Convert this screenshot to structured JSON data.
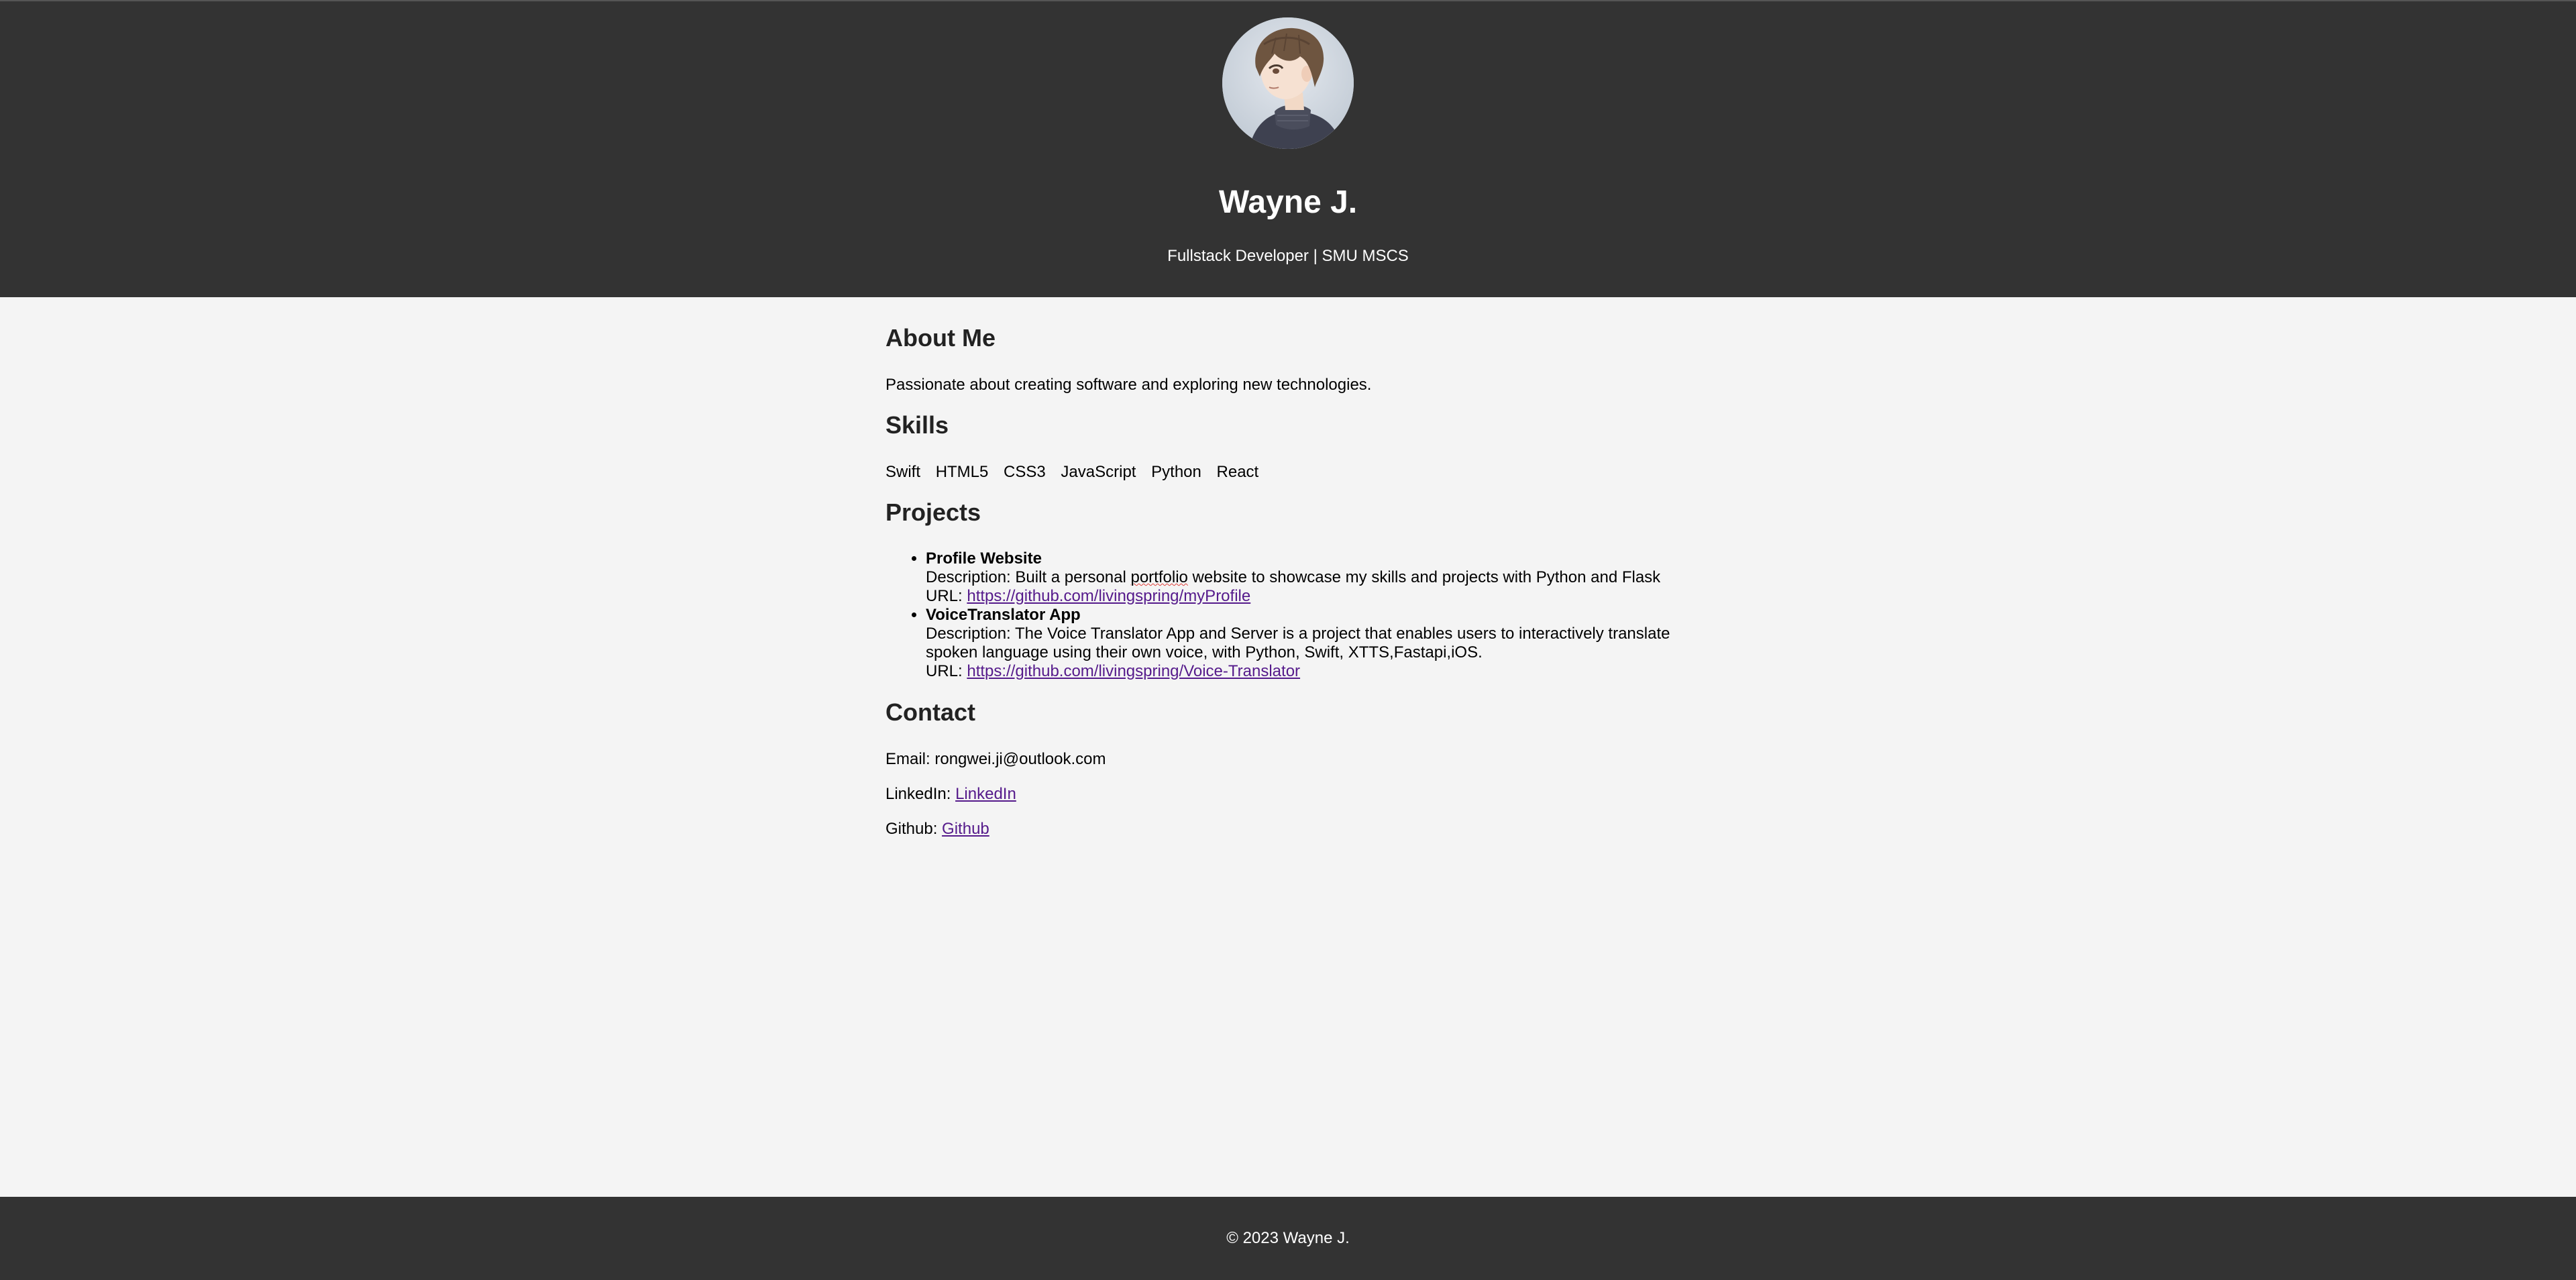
{
  "header": {
    "name": "Wayne J.",
    "tagline": "Fullstack Developer | SMU MSCS",
    "avatar_icon": "avatar-portrait-icon"
  },
  "about": {
    "heading": "About Me",
    "text": "Passionate about creating software and exploring new technologies."
  },
  "skills": {
    "heading": "Skills",
    "items": [
      "Swift",
      "HTML5",
      "CSS3",
      "JavaScript",
      "Python",
      "React"
    ]
  },
  "projects": {
    "heading": "Projects",
    "items": [
      {
        "title": "Profile Website",
        "desc_prefix": "Description: Built a personal ",
        "desc_flagged": "portfolio",
        "desc_suffix": " website to showcase my skills and projects with Python and Flask",
        "url_label": "URL: ",
        "url": "https://github.com/livingspring/myProfile"
      },
      {
        "title": "VoiceTranslator App",
        "desc_line1": "Description: The Voice Translator App and Server is a project that enables users to interactively translate",
        "desc_line2": "spoken language using their own voice, with Python, Swift, XTTS,Fastapi,iOS.",
        "url_label": "URL: ",
        "url": "https://github.com/livingspring/Voice-Translator"
      }
    ]
  },
  "contact": {
    "heading": "Contact",
    "email_label": "Email: ",
    "email": "rongwei.ji@outlook.com",
    "linkedin_label": "LinkedIn: ",
    "linkedin_link": "LinkedIn",
    "github_label": "Github: ",
    "github_link": "Github"
  },
  "footer": {
    "text": "© 2023 Wayne J."
  },
  "colors": {
    "header_bg": "#333333",
    "page_bg": "#f4f4f4",
    "link": "#551a8b"
  }
}
